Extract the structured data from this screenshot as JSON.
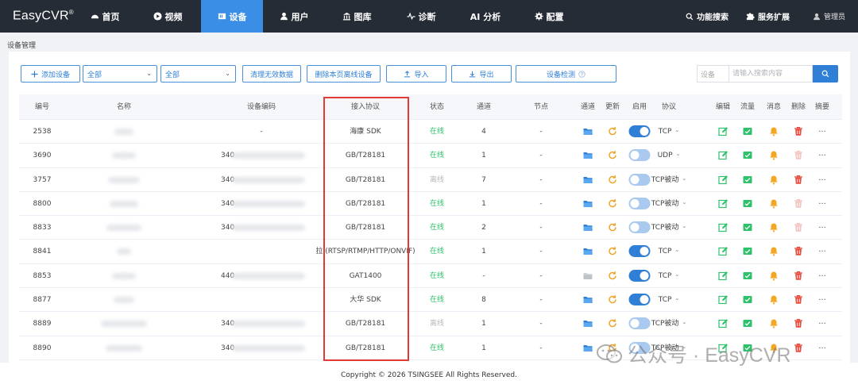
{
  "app": {
    "logo": "EasyCVR",
    "logo_mark": "®"
  },
  "nav": {
    "items": [
      {
        "label": "首页",
        "icon": "dashboard-icon",
        "active": false
      },
      {
        "label": "视频",
        "icon": "play-icon",
        "active": false
      },
      {
        "label": "设备",
        "icon": "device-icon",
        "active": true
      },
      {
        "label": "用户",
        "icon": "user-icon",
        "active": false
      },
      {
        "label": "图库",
        "icon": "gallery-icon",
        "active": false
      },
      {
        "label": "诊断",
        "icon": "pulse-icon",
        "active": false
      },
      {
        "label": "AI 分析",
        "icon": "",
        "active": false
      },
      {
        "label": "配置",
        "icon": "gear-icon",
        "active": false
      }
    ],
    "right": [
      {
        "label": "功能搜索",
        "icon": "search-icon"
      },
      {
        "label": "服务扩展",
        "icon": "puzzle-icon"
      },
      {
        "label": "管理员",
        "icon": "user-icon"
      }
    ]
  },
  "page": {
    "title": "设备管理"
  },
  "toolbar": {
    "add_label": "添加设备",
    "select1_value": "全部",
    "select2_value": "全部",
    "clean_label": "清理无效数据",
    "delete_offline_label": "删除本页离线设备",
    "import_label": "导入",
    "export_label": "导出",
    "detect_label": "设备检测",
    "search_prefix": "设备",
    "search_placeholder": "请输入搜索内容"
  },
  "table": {
    "columns": [
      "编号",
      "名称",
      "设备编码",
      "接入协议",
      "状态",
      "通道",
      "节点",
      "通道",
      "更新",
      "启用",
      "协议",
      "编辑",
      "流量",
      "消息",
      "删除",
      "摘要"
    ],
    "rows": [
      {
        "id": "2538",
        "code_prefix": "-",
        "protocol": "海康 SDK",
        "status": "在线",
        "online": true,
        "channels": "4",
        "node": "-",
        "folder_gray": false,
        "enabled": true,
        "transport": "TCP",
        "delete_faded": false
      },
      {
        "id": "3690",
        "code_prefix": "340",
        "protocol": "GB/T28181",
        "status": "在线",
        "online": true,
        "channels": "1",
        "node": "-",
        "folder_gray": false,
        "enabled": false,
        "transport": "UDP",
        "delete_faded": true
      },
      {
        "id": "3757",
        "code_prefix": "340",
        "protocol": "GB/T28181",
        "status": "离线",
        "online": false,
        "channels": "7",
        "node": "-",
        "folder_gray": false,
        "enabled": false,
        "transport": "TCP被动",
        "delete_faded": false
      },
      {
        "id": "8800",
        "code_prefix": "340",
        "protocol": "GB/T28181",
        "status": "在线",
        "online": true,
        "channels": "1",
        "node": "-",
        "folder_gray": false,
        "enabled": false,
        "transport": "TCP被动",
        "delete_faded": true
      },
      {
        "id": "8833",
        "code_prefix": "340",
        "protocol": "GB/T28181",
        "status": "在线",
        "online": true,
        "channels": "2",
        "node": "-",
        "folder_gray": false,
        "enabled": false,
        "transport": "TCP被动",
        "delete_faded": true
      },
      {
        "id": "8841",
        "code_prefix": "",
        "protocol": "拉 (RTSP/RTMP/HTTP/ONVIF)",
        "status": "在线",
        "online": true,
        "channels": "1",
        "node": "-",
        "folder_gray": false,
        "enabled": true,
        "transport": "TCP",
        "delete_faded": false
      },
      {
        "id": "8853",
        "code_prefix": "440",
        "protocol": "GAT1400",
        "status": "在线",
        "online": true,
        "channels": "-",
        "node": "-",
        "folder_gray": true,
        "enabled": true,
        "transport": "TCP",
        "delete_faded": false
      },
      {
        "id": "8877",
        "code_prefix": "",
        "protocol": "大华 SDK",
        "status": "在线",
        "online": true,
        "channels": "8",
        "node": "-",
        "folder_gray": false,
        "enabled": true,
        "transport": "TCP",
        "delete_faded": false
      },
      {
        "id": "8889",
        "code_prefix": "340",
        "protocol": "GB/T28181",
        "status": "离线",
        "online": false,
        "channels": "1",
        "node": "-",
        "folder_gray": false,
        "enabled": false,
        "transport": "TCP被动",
        "delete_faded": false
      },
      {
        "id": "8890",
        "code_prefix": "340",
        "protocol": "GB/T28181",
        "status": "在线",
        "online": true,
        "channels": "1",
        "node": "-",
        "folder_gray": false,
        "enabled": false,
        "transport": "TCP被动",
        "delete_faded": false
      }
    ]
  },
  "footer": {
    "copyright": "Copyright © 2026 TSINGSEE All Rights Reserved."
  },
  "watermark": {
    "text": "公众号 · EasyCVR"
  },
  "colors": {
    "nav_bg": "#262c35",
    "accent": "#2f7fd6",
    "online": "#2ec06b",
    "offline": "#b9b9b9",
    "update_orange": "#f0a020",
    "bell_orange": "#f5a623",
    "delete_red": "#e84c3d",
    "edit_green": "#2ec06b",
    "highlight": "#e53935"
  }
}
